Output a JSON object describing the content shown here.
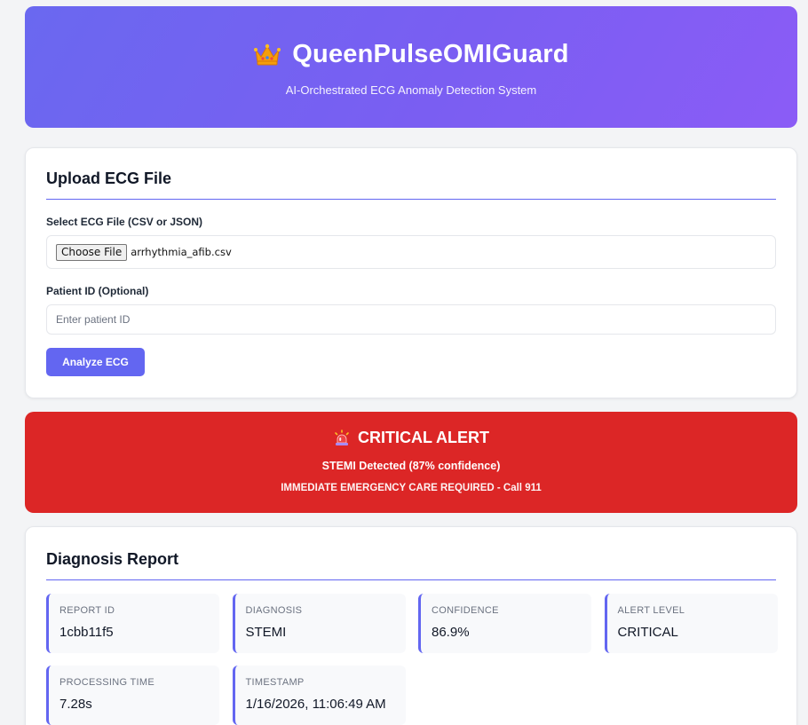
{
  "header": {
    "title": "QueenPulseOMIGuard",
    "subtitle": "AI-Orchestrated ECG Anomaly Detection System",
    "icon": "crown-icon"
  },
  "upload": {
    "section_title": "Upload ECG File",
    "file_label": "Select ECG File (CSV or JSON)",
    "file_button": "Choose File",
    "file_name": "arrhythmia_afib.csv",
    "patient_label": "Patient ID (Optional)",
    "patient_placeholder": "Enter patient ID",
    "patient_value": "",
    "analyze_label": "Analyze ECG"
  },
  "alert": {
    "icon": "siren-icon",
    "title": "CRITICAL ALERT",
    "detail": "STEMI Detected (87% confidence)",
    "action": "IMMEDIATE EMERGENCY CARE REQUIRED - Call 911",
    "color": "#dc2626"
  },
  "report": {
    "section_title": "Diagnosis Report",
    "metrics": [
      {
        "label": "REPORT ID",
        "value": "1cbb11f5"
      },
      {
        "label": "DIAGNOSIS",
        "value": "STEMI"
      },
      {
        "label": "CONFIDENCE",
        "value": "86.9%"
      },
      {
        "label": "ALERT LEVEL",
        "value": "CRITICAL"
      },
      {
        "label": "PROCESSING TIME",
        "value": "7.28s"
      },
      {
        "label": "TIMESTAMP",
        "value": "1/16/2026, 11:06:49 AM"
      }
    ]
  },
  "colors": {
    "accent": "#6366f1",
    "header_gradient_start": "#6a68f0",
    "header_gradient_end": "#8b5cf6",
    "critical": "#dc2626"
  }
}
